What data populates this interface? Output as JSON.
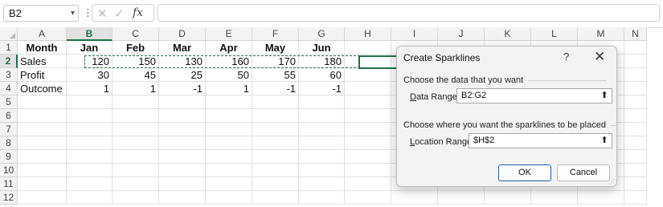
{
  "formula_bar": {
    "name_box": "B2",
    "dots": "⋮",
    "cancel_icon": "✕",
    "enter_icon": "✓",
    "fx_label": "fx",
    "formula": ""
  },
  "columns": [
    "A",
    "B",
    "C",
    "D",
    "E",
    "F",
    "G",
    "H",
    "I",
    "J",
    "K",
    "L",
    "M",
    "N"
  ],
  "rows": [
    "1",
    "2",
    "3",
    "4",
    "5",
    "6",
    "7",
    "8",
    "9",
    "10",
    "11",
    "12"
  ],
  "table": {
    "header": [
      "Month",
      "Jan",
      "Feb",
      "Mar",
      "Apr",
      "May",
      "Jun"
    ],
    "data": [
      [
        "Sales",
        "120",
        "150",
        "130",
        "160",
        "170",
        "180"
      ],
      [
        "Profit",
        "30",
        "45",
        "25",
        "50",
        "55",
        "60"
      ],
      [
        "Outcome",
        "1",
        "1",
        "-1",
        "1",
        "-1",
        "-1"
      ]
    ]
  },
  "dialog": {
    "title": "Create Sparklines",
    "help": "?",
    "close": "✕",
    "section1": "Choose the data that you want",
    "data_range_label_u": "D",
    "data_range_label_rest": "ata Range:",
    "data_range_value": "B2:G2",
    "section2": "Choose where you want the sparklines to be placed",
    "location_range_label_u": "L",
    "location_range_label_rest": "ocation Range:",
    "location_range_value": "$H$2",
    "collapse_icon": "⬆",
    "ok_label": "OK",
    "cancel_label": "Cancel"
  },
  "colors": {
    "accent": "#1f7145",
    "button_focus": "#1f5fa8"
  },
  "icons": [
    "chevron-down-icon",
    "cancel-icon",
    "check-icon",
    "fx-icon",
    "collapse-dialog-icon",
    "close-icon",
    "help-icon",
    "resize-grip-icon"
  ]
}
